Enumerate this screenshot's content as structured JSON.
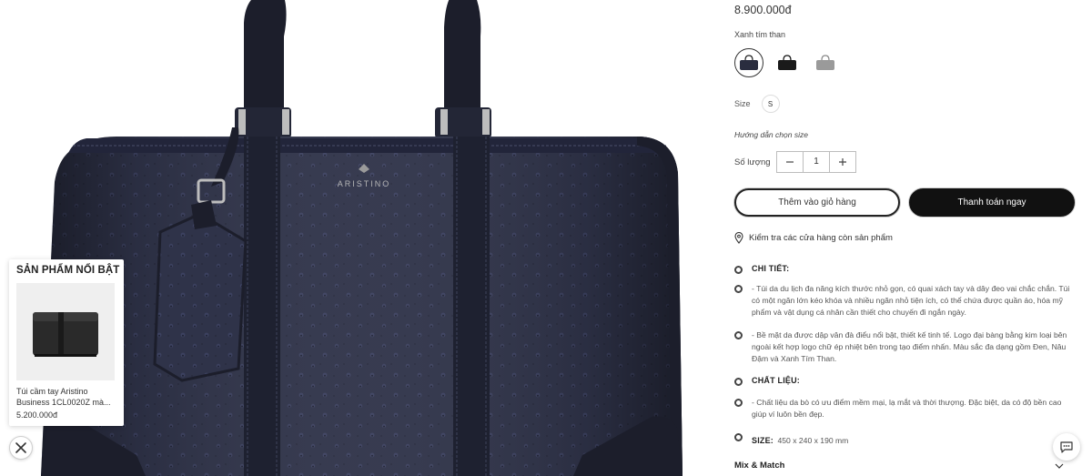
{
  "product": {
    "price": "8.900.000đ",
    "color_label": "Xanh tím than",
    "swatches": [
      {
        "name": "Xanh tím than",
        "color": "#2a2d3f",
        "active": true
      },
      {
        "name": "Đen",
        "color": "#1a1a1a",
        "active": false
      },
      {
        "name": "Xám",
        "color": "#9a9a9a",
        "active": false
      }
    ],
    "size_label": "Size",
    "size_value": "S",
    "size_guide": "Hướng dẫn chọn size",
    "qty_label": "Số lượng",
    "qty_value": "1",
    "add_to_cart": "Thêm vào giỏ hàng",
    "buy_now": "Thanh toán ngay",
    "store_check": "Kiểm tra các cửa hàng còn sản phẩm",
    "brand_logo": "ARISTINO"
  },
  "details": {
    "detail_head": "CHI TIẾT:",
    "detail_1": "- Túi da du lịch đa năng kích thước nhỏ gọn, có quai xách tay và dây đeo vai chắc chắn. Túi có một ngăn lớn kéo khóa và nhiều ngăn nhỏ tiện ích, có thể chứa được quần áo, hóa mỹ phẩm và vật dụng cá nhân cần thiết cho chuyến đi ngắn ngày.",
    "detail_2": "- Bề mặt da được dập vân đà điểu nổi bật, thiết kế tinh tế. Logo đại bàng bằng kim loại bên ngoài kết hợp logo chữ ép nhiệt bên trong tạo điểm nhấn. Màu sắc đa dạng gồm Đen, Nâu Đậm và Xanh Tím Than.",
    "material_head": "CHẤT LIỆU:",
    "material_1": "- Chất liệu da bò có ưu điểm mềm mại, lạ mắt và thời thượng. Đặc biệt, da có độ bền cao giúp ví luôn bền đẹp.",
    "size_head": "SIZE:",
    "size_text": "450 x 240 x 190 mm",
    "mix_match": "Mix & Match"
  },
  "featured": {
    "title": "SẢN PHẨM NỔI BẬT",
    "item_name": "Túi cầm tay Aristino Business 1CL0020Z mà...",
    "item_price": "5.200.000đ"
  },
  "icons": {
    "close": "close-icon",
    "chat": "chat-icon",
    "location": "location-pin-icon"
  },
  "colors": {
    "bag": "#2c2f45",
    "strap": "#1c1e2b",
    "accent": "#111111"
  }
}
